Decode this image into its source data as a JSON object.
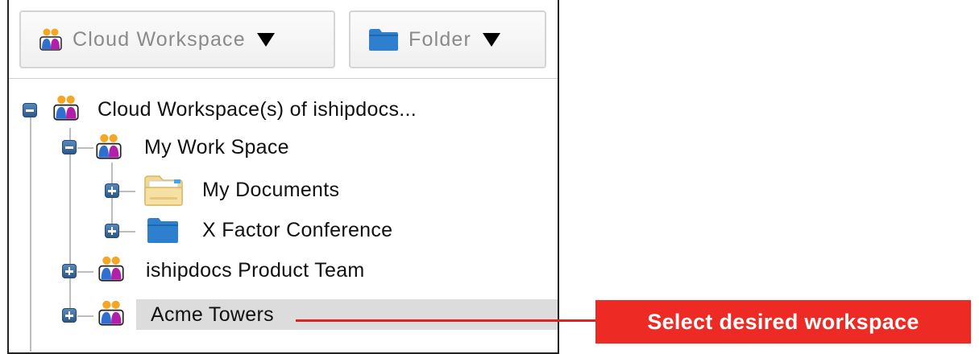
{
  "toolbar": {
    "workspace_dropdown": {
      "label": "Cloud Workspace",
      "icon": "team-icon"
    },
    "folder_dropdown": {
      "label": "Folder",
      "icon": "folder-icon"
    }
  },
  "tree": {
    "root": {
      "label": "Cloud Workspace(s) of ishipdocs...",
      "expanded": true
    },
    "my_work_space": {
      "label": "My Work Space",
      "expanded": true
    },
    "my_documents": {
      "label": "My Documents",
      "expanded": false
    },
    "x_factor": {
      "label": "X Factor Conference",
      "expanded": false
    },
    "product_team": {
      "label": "ishipdocs Product Team",
      "expanded": false
    },
    "acme": {
      "label": "Acme Towers",
      "expanded": false,
      "selected": true
    }
  },
  "callout": {
    "text": "Select desired workspace"
  },
  "colors": {
    "accent_red": "#ee2a24",
    "toggle_blue": "#2a5586",
    "folder_blue": "#2f7fcf",
    "selection_gray": "#dcdcdc"
  }
}
